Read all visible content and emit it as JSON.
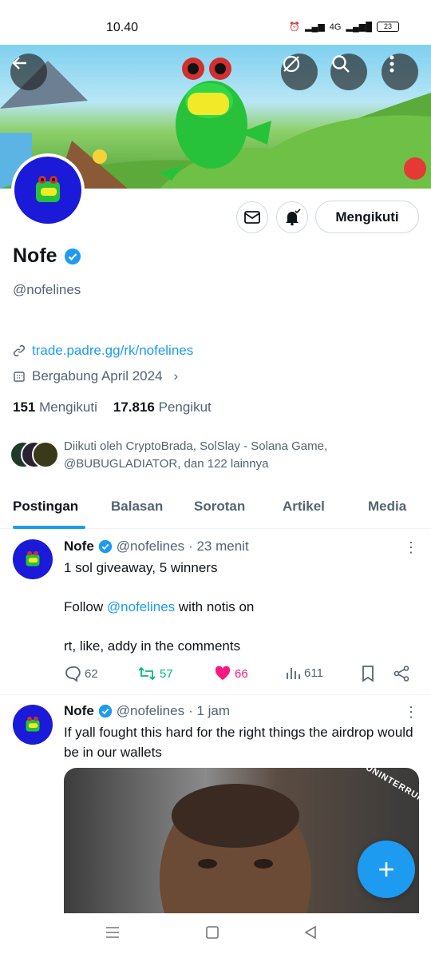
{
  "status_bar": {
    "time": "10.40",
    "network": "4G",
    "battery": "23"
  },
  "header": {
    "back_icon": "arrow-left-icon",
    "icons": [
      "grok-icon",
      "search-icon",
      "more-vertical-icon"
    ]
  },
  "profile": {
    "name": "Nofe",
    "verified": true,
    "handle": "@nofelines",
    "link": "trade.padre.gg/rk/nofelines",
    "joined": "Bergabung April 2024",
    "following_count": "151",
    "following_label": "Mengikuti",
    "followers_count": "17.816",
    "followers_label": "Pengikut",
    "followed_by": "Diikuti oleh CryptoBrada, SolSlay - Solana Game, @BUBUGLADIATOR, dan 122 lainnya",
    "follow_button": "Mengikuti"
  },
  "tabs": [
    "Postingan",
    "Balasan",
    "Sorotan",
    "Artikel",
    "Media"
  ],
  "tweets": [
    {
      "name": "Nofe",
      "handle": "@nofelines",
      "time": "· 23 menit",
      "line1": "1 sol giveaway, 5 winners",
      "line2_pre": "Follow ",
      "line2_mention": "@nofelines",
      "line2_post": " with notis on",
      "line3": "rt, like, addy in the comments",
      "replies": "62",
      "retweets": "57",
      "likes": "66",
      "views": "611"
    },
    {
      "name": "Nofe",
      "handle": "@nofelines",
      "time": "· 1 jam",
      "text": "If yall fought this hard for the right things the airdrop would be in our wallets",
      "media_watermark": "UNINTERRUPTED"
    }
  ],
  "colors": {
    "accent": "#1d9bf0",
    "like": "#f91880",
    "retweet": "#00ba7c",
    "avatar_bg": "#1a1ad8"
  }
}
